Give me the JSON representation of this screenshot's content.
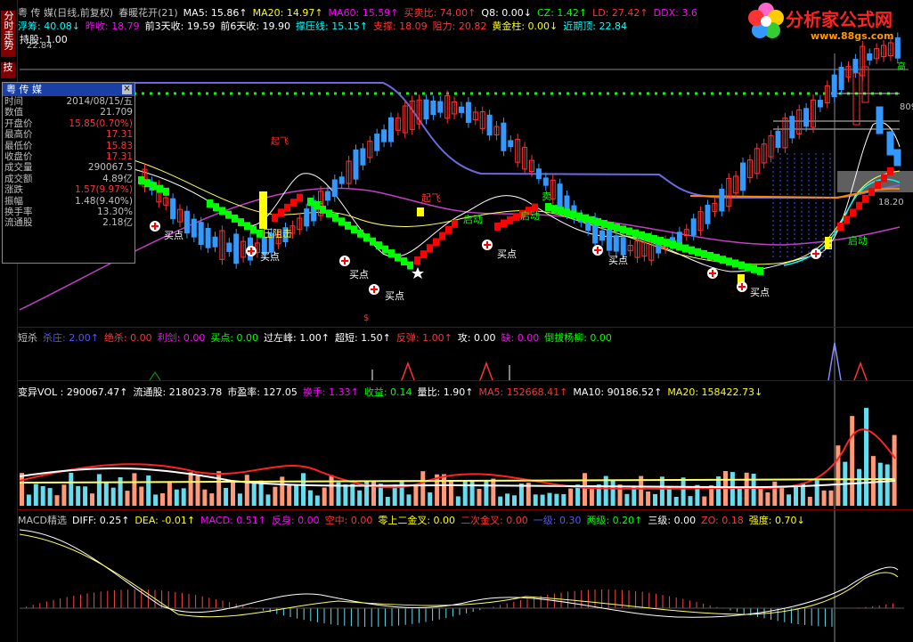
{
  "sidebar": {
    "tab1": "分时走势",
    "tab2": "技"
  },
  "main_header": {
    "row1": [
      {
        "t": "粤 传 媒(日线,前复权)",
        "c": "#c0c0c0"
      },
      {
        "t": "春暖花开(21)",
        "c": "#c0c0c0"
      },
      {
        "t": "MA5: 15.86↑",
        "c": "#ffffff"
      },
      {
        "t": "MA20: 14.97↑",
        "c": "#ffff00"
      },
      {
        "t": "MA60: 15.59↑",
        "c": "#ff00ff"
      },
      {
        "t": "买卖比: 74.00↑",
        "c": "#ff3333"
      },
      {
        "t": "Q8: 0.00↓",
        "c": "#ffffff"
      },
      {
        "t": "CZ: 1.42↑",
        "c": "#00ff00"
      },
      {
        "t": "LD: 27.42↑",
        "c": "#ff3333"
      },
      {
        "t": "DDX: 3.6",
        "c": "#ff00ff"
      }
    ],
    "row2": [
      {
        "t": "浮筹: 40.08↓",
        "c": "#00ffff"
      },
      {
        "t": "昨收: 18.79",
        "c": "#ff00ff"
      },
      {
        "t": "前3天收: 19.59",
        "c": "#ffffff"
      },
      {
        "t": "前6天收: 19.90",
        "c": "#ffffff"
      },
      {
        "t": "撑压线: 15.15↑",
        "c": "#00ffff"
      },
      {
        "t": "支撑: 18.09",
        "c": "#ff3333"
      },
      {
        "t": "阻力: 20.82",
        "c": "#ff3333"
      },
      {
        "t": "黄金柱: 0.00↓",
        "c": "#ffff00"
      },
      {
        "t": "近期顶: 22.84",
        "c": "#00ffff"
      }
    ],
    "row3": "持股: 1.00",
    "top_price": "22.84"
  },
  "infobox": {
    "title": "粤 传 媒",
    "rows": [
      {
        "k": "时间",
        "v": "2014/08/15/五",
        "red": false
      },
      {
        "k": "数值",
        "v": "21.709",
        "red": false
      },
      {
        "k": "开盘价",
        "v": "15.85(0.70%)",
        "red": true
      },
      {
        "k": "最高价",
        "v": "17.31",
        "red": true
      },
      {
        "k": "最低价",
        "v": "15.83",
        "red": true
      },
      {
        "k": "收盘价",
        "v": "17.31",
        "red": true
      },
      {
        "k": "成交量",
        "v": "290067.5",
        "red": false
      },
      {
        "k": "成交额",
        "v": "4.89亿",
        "red": false
      },
      {
        "k": "涨跌",
        "v": "1.57(9.97%)",
        "red": true
      },
      {
        "k": "振幅",
        "v": "1.48(9.40%)",
        "red": false
      },
      {
        "k": "换手率",
        "v": "13.30%",
        "red": false
      },
      {
        "k": "流通股",
        "v": "2.18亿",
        "red": false
      }
    ]
  },
  "logo": {
    "text": "分析家公式网",
    "url": "www.88gs.com"
  },
  "annotations": {
    "buy": "买点",
    "block": "压阻击",
    "sell": "卖",
    "rise": "启动",
    "fly": "起飞",
    "start": "启动",
    "high": "高",
    "right_price_1": "809",
    "right_price_2": "18.20",
    "dollar": "$"
  },
  "panel2": {
    "items": [
      {
        "t": "短杀",
        "c": "#c0c0c0"
      },
      {
        "t": "杀庄: 2.00↑",
        "c": "#5555ff"
      },
      {
        "t": "绝杀: 0.00",
        "c": "#ff3333"
      },
      {
        "t": "利剑: 0.00",
        "c": "#ff00ff"
      },
      {
        "t": "买点: 0.00",
        "c": "#00ff00"
      },
      {
        "t": "过左峰: 1.00↑",
        "c": "#ffffff"
      },
      {
        "t": "超短: 1.50↑",
        "c": "#ffffff"
      },
      {
        "t": "反弹: 1.00↑",
        "c": "#ff3333"
      },
      {
        "t": "攻: 0.00",
        "c": "#ffffff"
      },
      {
        "t": "缺: 0.00",
        "c": "#ff00ff"
      },
      {
        "t": "倒拔杨柳: 0.00",
        "c": "#00ff00"
      }
    ]
  },
  "panel3": {
    "items": [
      {
        "t": "变异VOL : 290067.47↑",
        "c": "#ffffff"
      },
      {
        "t": "流通股: 218023.78",
        "c": "#ffffff"
      },
      {
        "t": "市盈率: 127.05",
        "c": "#ffffff"
      },
      {
        "t": "换手: 1.33↑",
        "c": "#ff00ff"
      },
      {
        "t": "收益: 0.14",
        "c": "#00ff00"
      },
      {
        "t": "量比: 1.90↑",
        "c": "#ffffff"
      },
      {
        "t": "MA5: 152668.41↑",
        "c": "#ff3333"
      },
      {
        "t": "MA10: 90186.52↑",
        "c": "#ffffff"
      },
      {
        "t": "MA20: 158422.73↓",
        "c": "#ffff00"
      }
    ]
  },
  "panel4": {
    "items": [
      {
        "t": "MACD精选",
        "c": "#c0c0c0"
      },
      {
        "t": "DIFF: 0.25↑",
        "c": "#ffffff"
      },
      {
        "t": "DEA: -0.01↑",
        "c": "#ffff00"
      },
      {
        "t": "MACD: 0.51↑",
        "c": "#ff00ff"
      },
      {
        "t": "反身: 0.00",
        "c": "#ff00ff"
      },
      {
        "t": "空中: 0.00",
        "c": "#ff3333"
      },
      {
        "t": "零上二金叉: 0.00",
        "c": "#ffff00"
      },
      {
        "t": "二次金叉: 0.00",
        "c": "#ff3333"
      },
      {
        "t": "一级: 0.30",
        "c": "#5555ff"
      },
      {
        "t": "两级: 0.20↑",
        "c": "#00ff00"
      },
      {
        "t": "三级: 0.00",
        "c": "#ffffff"
      },
      {
        "t": "ZO: 0.18",
        "c": "#ff3333"
      },
      {
        "t": "强度: 0.70↓",
        "c": "#ffff00"
      }
    ]
  },
  "chart_data": [
    {
      "type": "candlestick",
      "title": "粤 传 媒(日线,前复权)",
      "series": [
        {
          "name": "MA5",
          "latest": 15.86
        },
        {
          "name": "MA20",
          "latest": 14.97
        },
        {
          "name": "MA60",
          "latest": 15.59
        }
      ],
      "recent_top": 22.84,
      "support": 18.09,
      "resistance": 20.82
    },
    {
      "type": "bar",
      "title": "变异VOL",
      "latest_volume": 290067.47,
      "ma5": 152668.41,
      "ma10": 90186.52,
      "ma20": 158422.73
    },
    {
      "type": "bar",
      "title": "MACD精选",
      "diff": 0.25,
      "dea": -0.01,
      "macd": 0.51
    }
  ]
}
